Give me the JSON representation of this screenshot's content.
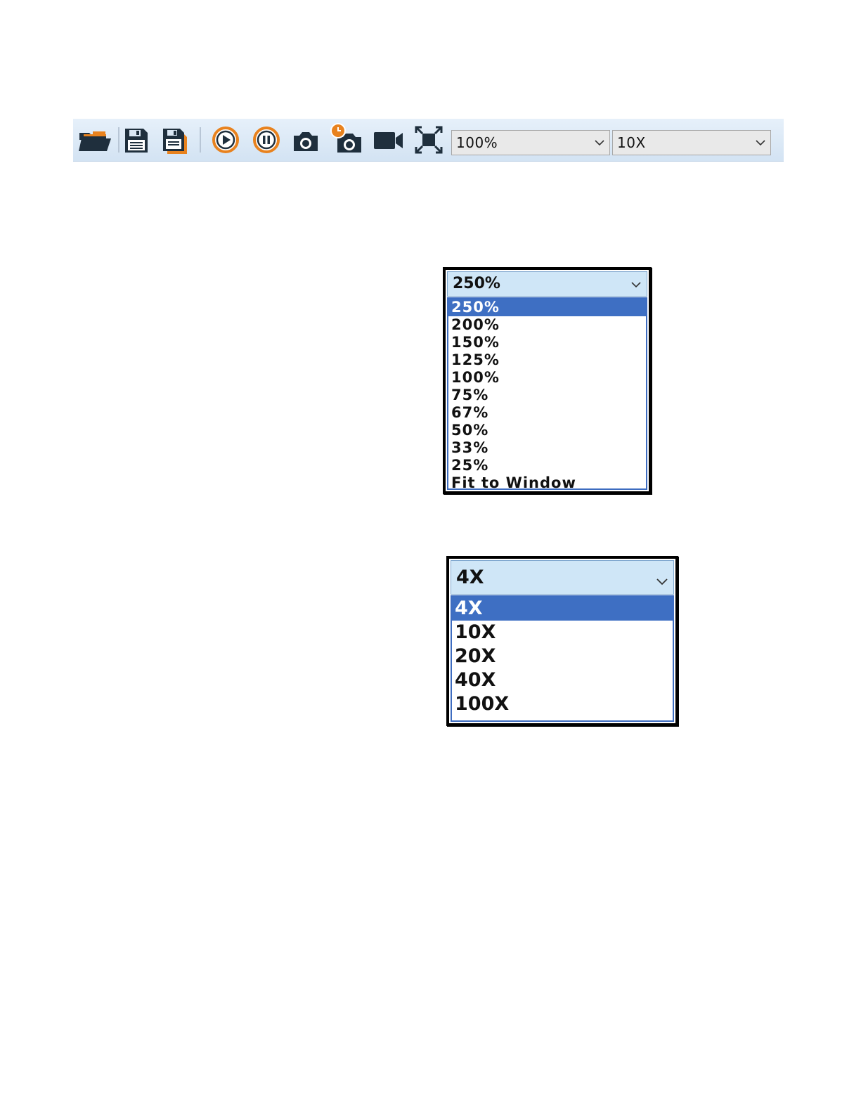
{
  "toolbar": {
    "icons": [
      "open-folder-icon",
      "save-icon",
      "save-as-icon",
      "play-icon",
      "pause-icon",
      "camera-icon",
      "timed-capture-icon",
      "video-camera-icon",
      "fullscreen-icon"
    ],
    "zoom_value": "100%",
    "magnification_value": "10X"
  },
  "zoom_dropdown": {
    "selected": "250%",
    "options": [
      "250%",
      "200%",
      "150%",
      "125%",
      "100%",
      "75%",
      "67%",
      "50%",
      "33%",
      "25%",
      "Fit to Window"
    ]
  },
  "magnification_dropdown": {
    "selected": "4X",
    "options": [
      "4X",
      "10X",
      "20X",
      "40X",
      "100X"
    ]
  },
  "colors": {
    "accent_orange": "#e8821e",
    "icon_dark": "#1f2f3d",
    "selection_blue": "#3e6fc3",
    "toolbar_bg": "#dbe8f5"
  }
}
